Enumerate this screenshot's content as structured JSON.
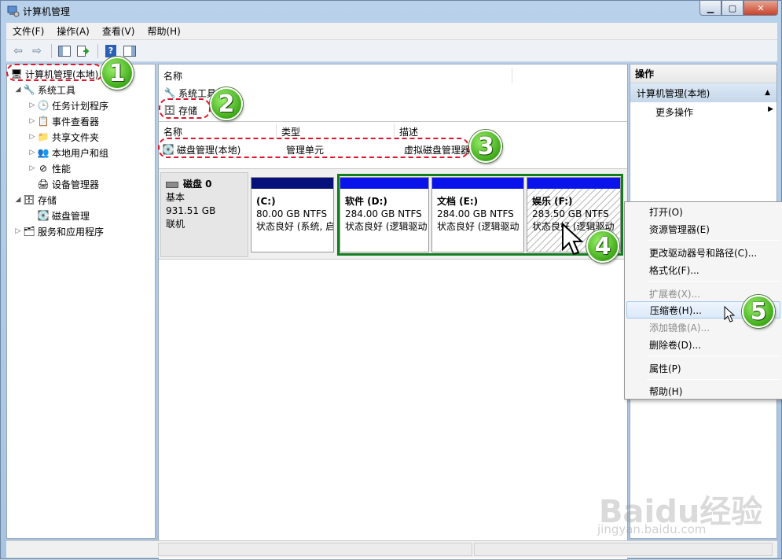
{
  "window": {
    "title": "计算机管理"
  },
  "menubar": {
    "items": [
      "文件(F)",
      "操作(A)",
      "查看(V)",
      "帮助(H)"
    ]
  },
  "tree": {
    "root": "计算机管理(本地)",
    "system_tools": "系统工具",
    "task_scheduler": "任务计划程序",
    "event_viewer": "事件查看器",
    "shared_folders": "共享文件夹",
    "local_users": "本地用户和组",
    "performance": "性能",
    "device_manager": "设备管理器",
    "storage": "存储",
    "disk_management": "磁盘管理",
    "services": "服务和应用程序"
  },
  "top_list": {
    "header": "名称",
    "items": [
      "系统工具",
      "存储"
    ]
  },
  "vol_list": {
    "headers": {
      "name": "名称",
      "type": "类型",
      "desc": "描述"
    },
    "row": {
      "name": "磁盘管理(本地)",
      "type": "管理单元",
      "desc": "虚拟磁盘管理器"
    }
  },
  "disk": {
    "name": "磁盘 0",
    "kind": "基本",
    "size": "931.51 GB",
    "status": "联机",
    "partitions": [
      {
        "label": "(C:)",
        "size": "80.00 GB NTFS",
        "status": "状态良好 (系统, 启"
      },
      {
        "label": "软件 (D:)",
        "size": "284.00 GB NTFS",
        "status": "状态良好 (逻辑驱动"
      },
      {
        "label": "文档 (E:)",
        "size": "284.00 GB NTFS",
        "status": "状态良好 (逻辑驱动"
      },
      {
        "label": "娱乐 (F:)",
        "size": "283.50 GB NTFS",
        "status": "状态良好 (逻辑驱动"
      }
    ]
  },
  "actions": {
    "header": "操作",
    "section": "计算机管理(本地)",
    "more": "更多操作"
  },
  "context_menu": {
    "open": "打开(O)",
    "explore": "资源管理器(E)",
    "change_letter": "更改驱动器号和路径(C)...",
    "format": "格式化(F)...",
    "extend": "扩展卷(X)...",
    "shrink": "压缩卷(H)...",
    "add_mirror": "添加镜像(A)...",
    "delete": "删除卷(D)...",
    "properties": "属性(P)",
    "help": "帮助(H)"
  },
  "callouts": [
    "1",
    "2",
    "3",
    "4",
    "5"
  ],
  "watermark": {
    "logo": "Baidu经验",
    "url": "jingyan.baidu.com"
  },
  "colors": {
    "primary_partition": "#07117a",
    "logical_partition": "#0a14ea",
    "extended_frame": "#137e1e",
    "callout": "#e0152b"
  }
}
